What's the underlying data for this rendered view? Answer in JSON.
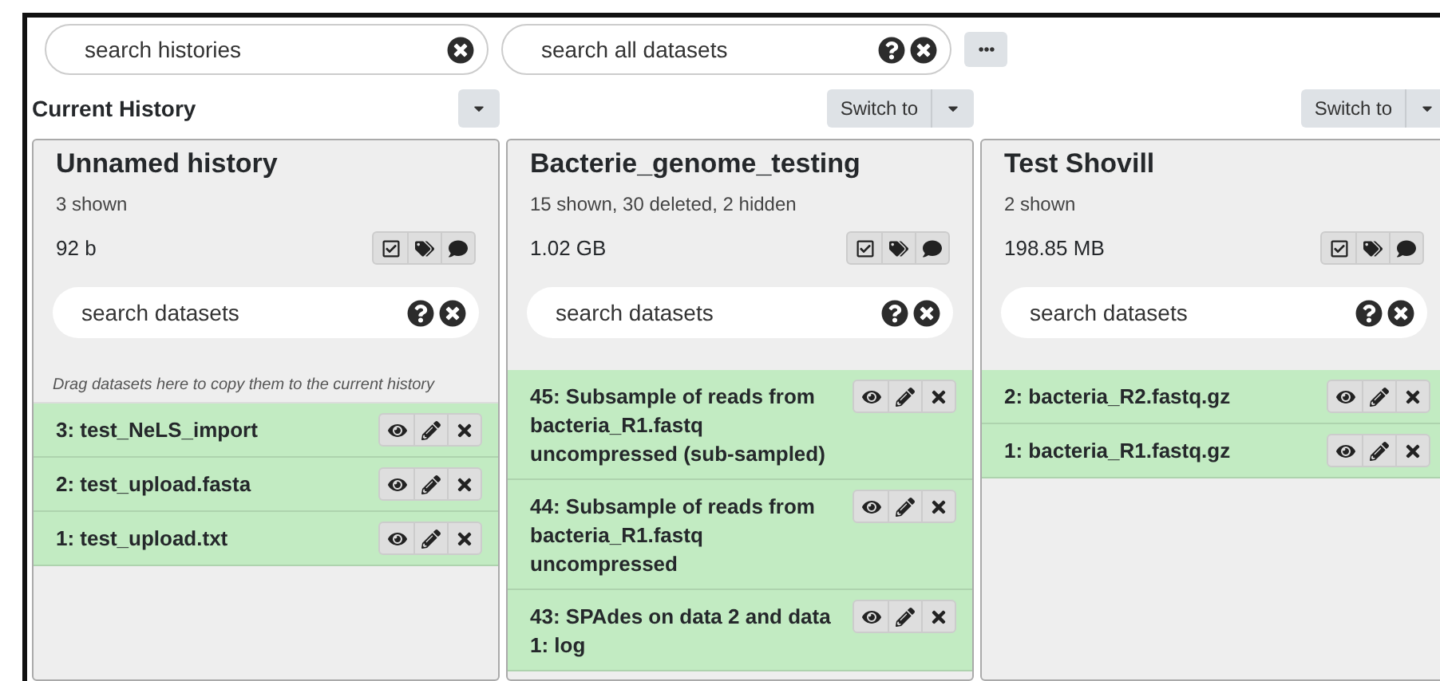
{
  "search_histories": {
    "placeholder": "search histories"
  },
  "search_all": {
    "placeholder": "search all datasets"
  },
  "histories": [
    {
      "header": {
        "kind": "current",
        "text": "Current History"
      },
      "name": "Unnamed history",
      "summary": "3 shown",
      "size": "92 b",
      "search": {
        "placeholder": "search datasets"
      },
      "drop_hint": "Drag datasets here to copy them to the current history",
      "datasets": [
        {
          "name": "3: test_NeLS_import"
        },
        {
          "name": "2: test_upload.fasta"
        },
        {
          "name": "1: test_upload.txt"
        }
      ]
    },
    {
      "header": {
        "kind": "switch",
        "text": "Switch to"
      },
      "name": "Bacterie_genome_testing",
      "summary": "15 shown, 30 deleted, 2 hidden",
      "size": "1.02 GB",
      "search": {
        "placeholder": "search datasets"
      },
      "datasets": [
        {
          "name": "45: Subsample of reads from bacteria_R1.fastq uncompressed (sub-sampled)"
        },
        {
          "name": "44: Subsample of reads from bacteria_R1.fastq uncompressed"
        },
        {
          "name": "43: SPAdes on data 2 and data 1: log"
        }
      ]
    },
    {
      "header": {
        "kind": "switch",
        "text": "Switch to"
      },
      "name": "Test Shovill",
      "summary": "2 shown",
      "size": "198.85 MB",
      "search": {
        "placeholder": "search datasets"
      },
      "datasets": [
        {
          "name": "2: bacteria_R2.fastq.gz"
        },
        {
          "name": "1: bacteria_R1.fastq.gz"
        }
      ]
    }
  ]
}
